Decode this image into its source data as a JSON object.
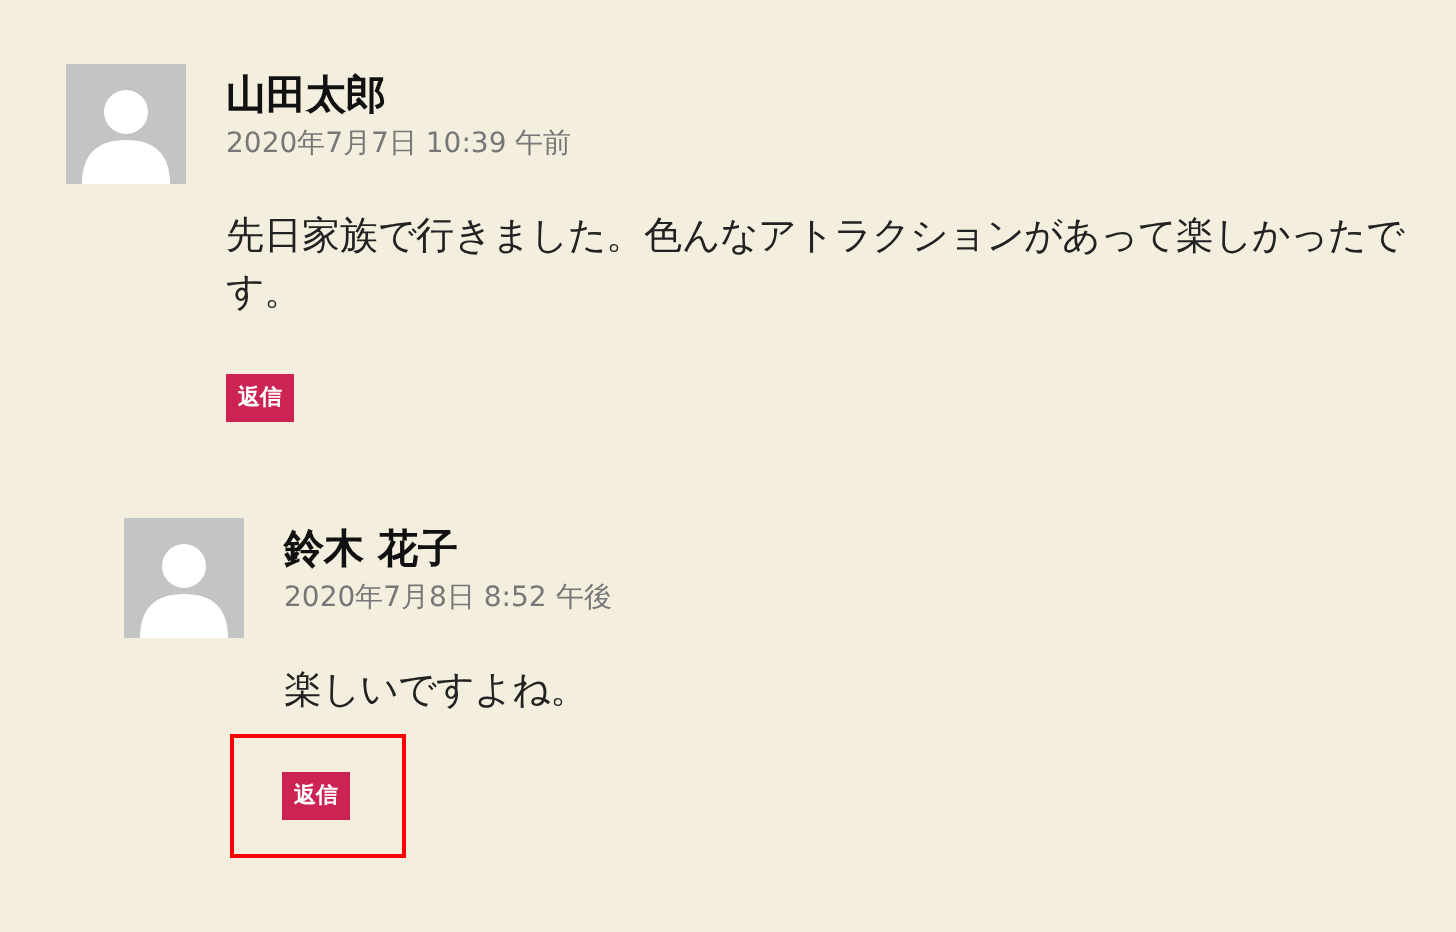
{
  "comments": [
    {
      "author": "山田太郎",
      "date": "2020年7月7日 10:39 午前",
      "body": "先日家族で行きました。色んなアトラクションがあって楽しかったです。",
      "reply": {
        "label": "返信",
        "highlighted": false
      },
      "children": [
        {
          "author": "鈴木 花子",
          "date": "2020年7月8日 8:52 午後",
          "body": "楽しいですよね。",
          "reply": {
            "label": "返信",
            "highlighted": true
          }
        }
      ]
    }
  ]
}
